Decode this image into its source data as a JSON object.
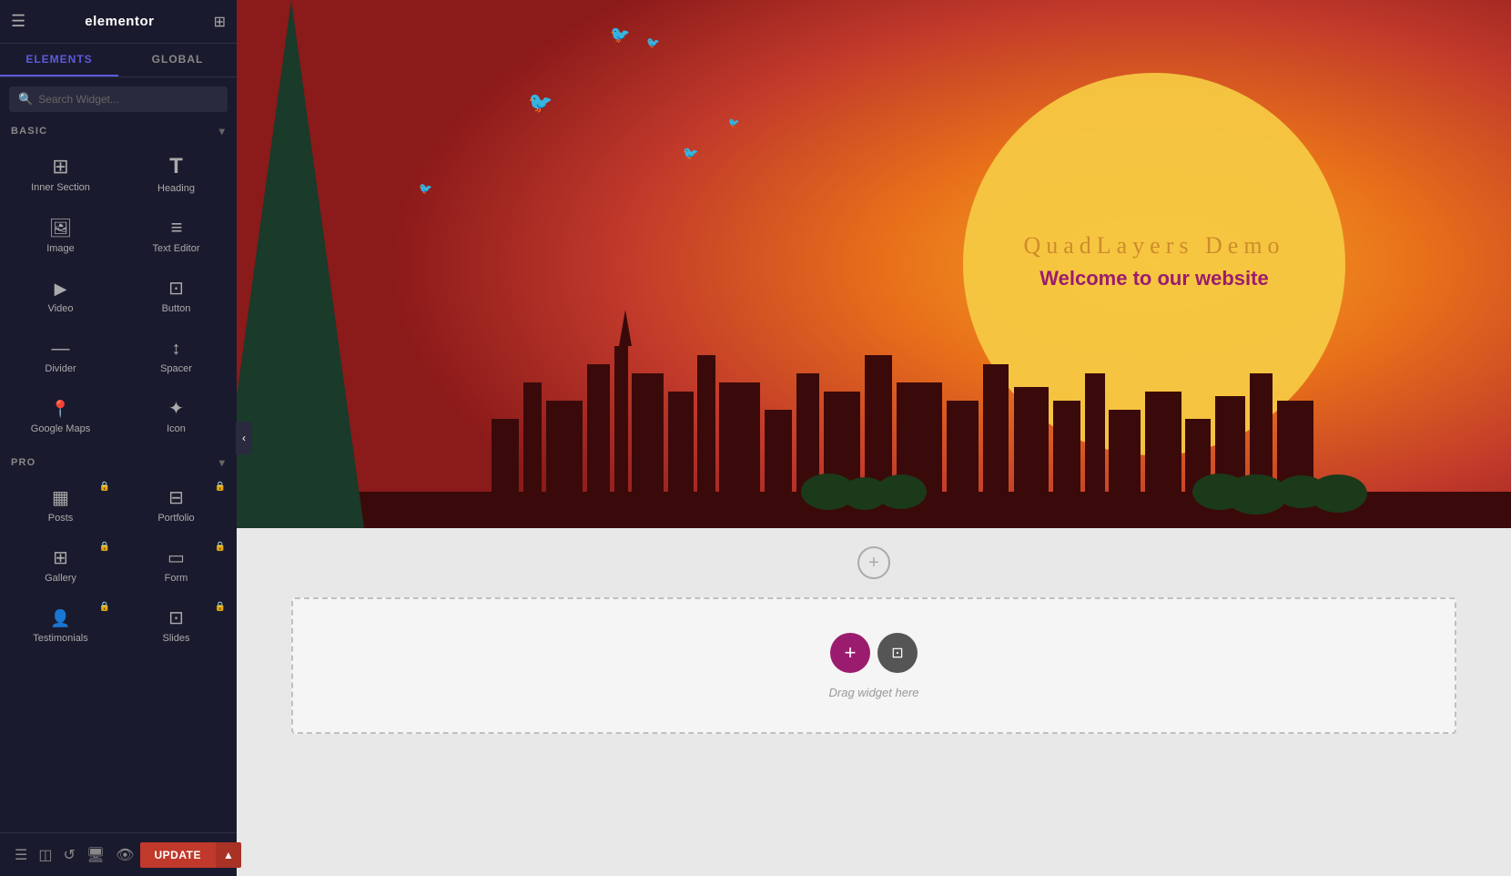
{
  "sidebar": {
    "logo": "elementor",
    "tabs": [
      {
        "id": "elements",
        "label": "ELEMENTS",
        "active": true
      },
      {
        "id": "global",
        "label": "GLOBAL",
        "active": false
      }
    ],
    "search_placeholder": "Search Widget...",
    "sections": {
      "basic": {
        "label": "BASIC",
        "widgets": [
          {
            "id": "inner-section",
            "label": "Inner Section",
            "icon": "inner-section"
          },
          {
            "id": "heading",
            "label": "Heading",
            "icon": "heading"
          },
          {
            "id": "image",
            "label": "Image",
            "icon": "image"
          },
          {
            "id": "text-editor",
            "label": "Text Editor",
            "icon": "text-editor"
          },
          {
            "id": "video",
            "label": "Video",
            "icon": "video"
          },
          {
            "id": "button",
            "label": "Button",
            "icon": "button"
          },
          {
            "id": "divider",
            "label": "Divider",
            "icon": "divider"
          },
          {
            "id": "spacer",
            "label": "Spacer",
            "icon": "spacer"
          },
          {
            "id": "google-maps",
            "label": "Google Maps",
            "icon": "maps"
          },
          {
            "id": "icon",
            "label": "Icon",
            "icon": "icon"
          }
        ]
      },
      "pro": {
        "label": "PRO",
        "widgets": [
          {
            "id": "posts",
            "label": "Posts",
            "icon": "posts",
            "locked": true
          },
          {
            "id": "portfolio",
            "label": "Portfolio",
            "icon": "portfolio",
            "locked": true
          },
          {
            "id": "gallery",
            "label": "Gallery",
            "icon": "gallery",
            "locked": true
          },
          {
            "id": "form",
            "label": "Form",
            "icon": "form",
            "locked": true
          },
          {
            "id": "person",
            "label": "Testimonials",
            "icon": "person",
            "locked": true
          },
          {
            "id": "widget2",
            "label": "Slides",
            "icon": "widget",
            "locked": true
          }
        ]
      }
    },
    "footer": {
      "update_label": "UPDATE"
    }
  },
  "canvas": {
    "hero": {
      "title": "QuadLayers Demo",
      "subtitle": "Welcome to our website"
    },
    "drop_zone": {
      "label": "Drag widget here"
    }
  }
}
